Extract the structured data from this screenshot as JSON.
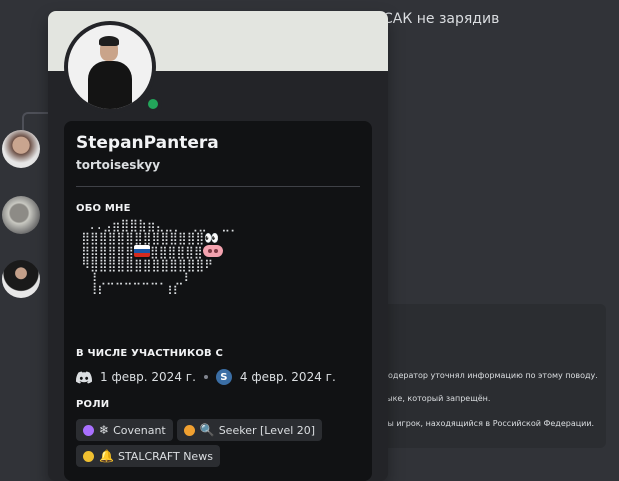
{
  "background": {
    "chat_line": "САК не зарядив",
    "embed_lines": [
      "модератор уточнял информацию по этому поводу.",
      "зыке, который запрещён.",
      "Вы игрок, находящийся в Российской Федерации."
    ]
  },
  "profile": {
    "display_name": "StepanPantera",
    "username": "tortoiseskyy",
    "status_color": "#23a55a",
    "about_title": "ОБО МНЕ",
    "member_since_title": "В ЧИСЛЕ УЧАСТНИКОВ С",
    "discord_since": "1 февр. 2024 г.",
    "server_since": "4 февр. 2024 г.",
    "server_icon_letter": "S",
    "roles_title": "РОЛИ",
    "roles": [
      {
        "name": "Covenant",
        "color": "#a970ff",
        "emoji": "❄"
      },
      {
        "name": "Seeker [Level 20]",
        "color": "#f0a030",
        "emoji": "🔍"
      },
      {
        "name": "STALCRAFT News",
        "color": "#f0c030",
        "emoji": "🔔"
      }
    ]
  }
}
